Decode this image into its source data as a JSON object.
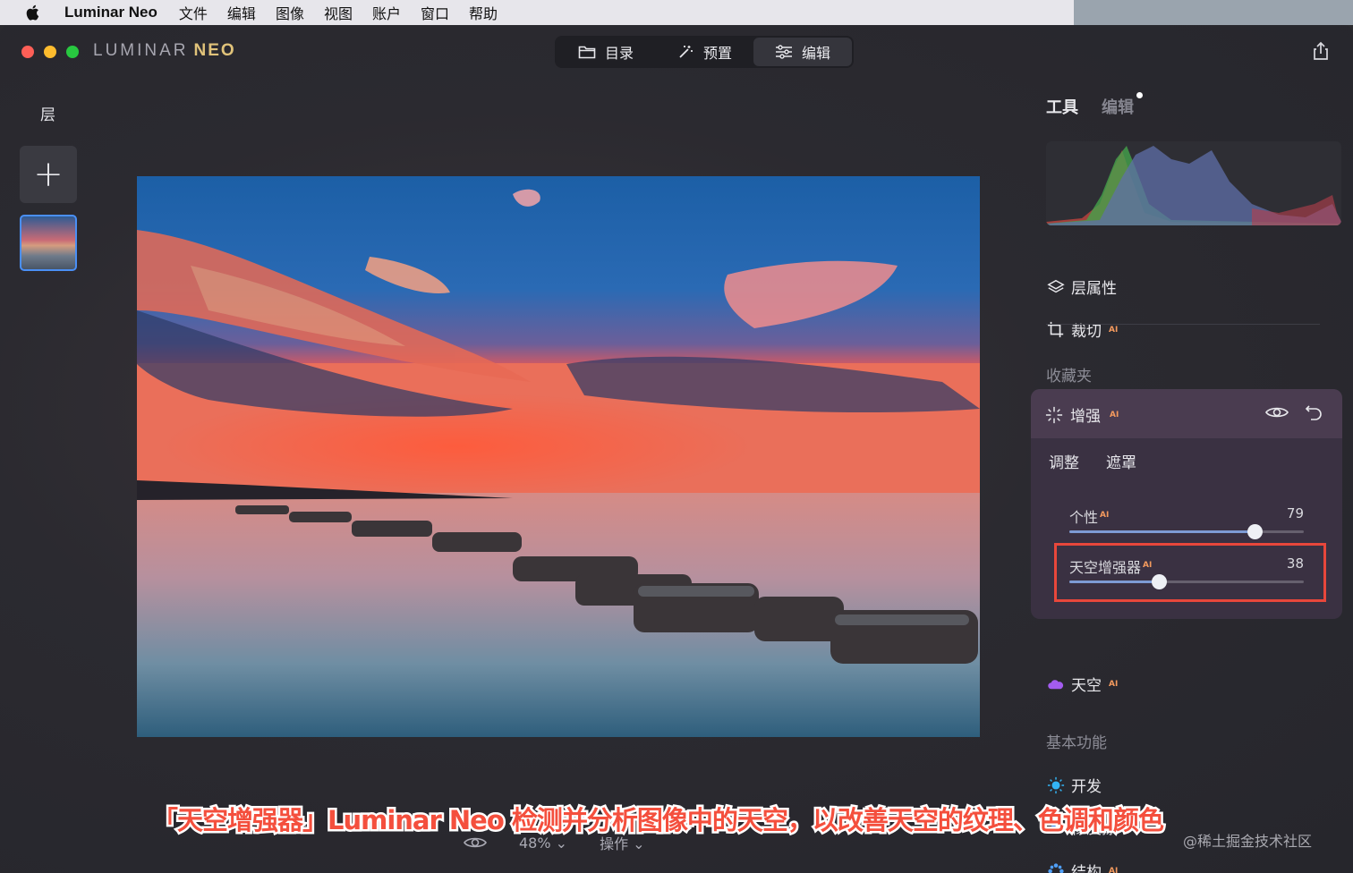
{
  "menubar": {
    "app": "Luminar Neo",
    "items": [
      "文件",
      "编辑",
      "图像",
      "视图",
      "账户",
      "窗口",
      "帮助"
    ]
  },
  "brand": {
    "name": "LUMINAR",
    "suffix": "NEO"
  },
  "nav": {
    "catalog": "目录",
    "presets": "预置",
    "edit": "编辑"
  },
  "layers": {
    "title": "层",
    "add_label": "+"
  },
  "right_tabs": {
    "tools": "工具",
    "edits": "编辑"
  },
  "tools": {
    "layer_properties": "层属性",
    "crop": "裁切",
    "ai_badge": "AI",
    "favorites": "收藏夹",
    "enhance": {
      "title": "增强",
      "tabs": {
        "adjust": "调整",
        "mask": "遮罩"
      },
      "sliders": [
        {
          "label": "个性",
          "value": 79,
          "fraction": 0.79
        },
        {
          "label": "天空增强器",
          "value": 38,
          "fraction": 0.38
        }
      ]
    },
    "sky": "天空",
    "essentials": "基本功能",
    "develop": "开发",
    "erase": "橡皮擦",
    "structure": "结构"
  },
  "bottom": {
    "zoom": "48%",
    "actions": "操作"
  },
  "caption": "「天空增强器」Luminar Neo 检测并分析图像中的天空，以改善天空的纹理、色调和颜色",
  "watermark": "@稀土掘金技术社区",
  "colors": {
    "accent_blue": "#4a8ff5",
    "highlight_red": "#e8473b",
    "ai_orange": "#f39a5e",
    "sky_purple": "#a35cf0",
    "develop_blue": "#33b4f5"
  }
}
